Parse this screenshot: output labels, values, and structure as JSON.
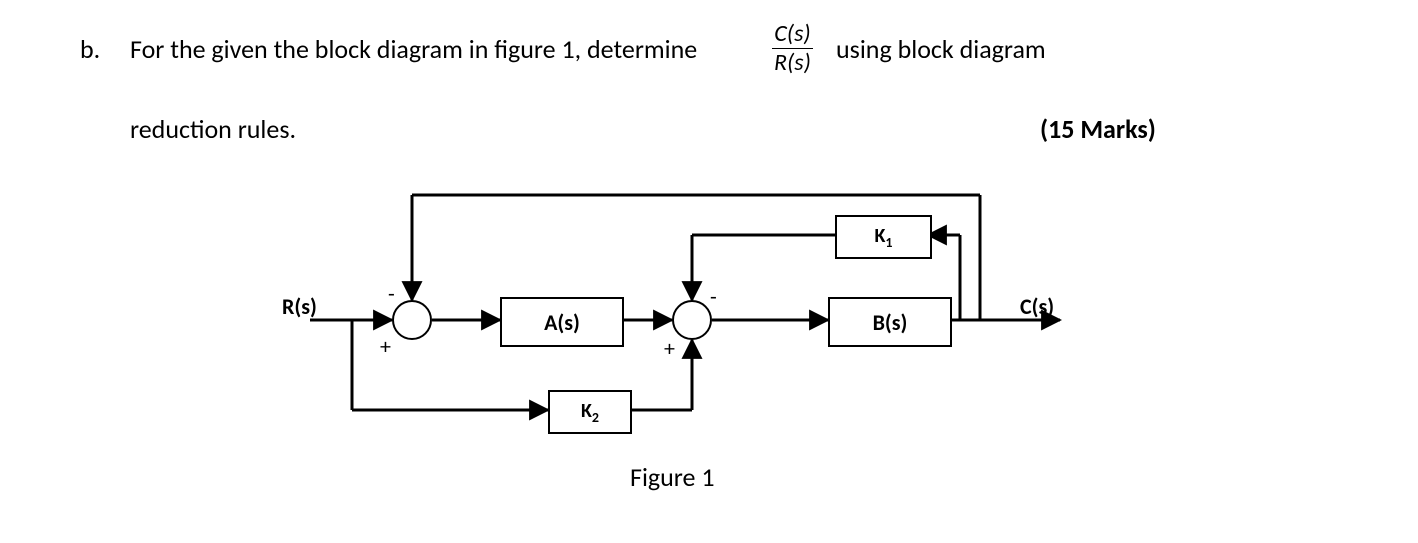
{
  "question": {
    "list_marker": "b.",
    "line1_a": "For the given the block diagram in figure 1, determine",
    "frac_num": "C(s)",
    "frac_den": "R(s)",
    "line1_b": "using block diagram",
    "line2": "reduction rules.",
    "marks": "(15 Marks)"
  },
  "diagram": {
    "input_label": "R(s)",
    "output_label": "C(s)",
    "blocks": {
      "A": "A(s)",
      "B": "B(s)",
      "K1": "K",
      "K1_sub": "1",
      "K2": "K",
      "K2_sub": "2"
    },
    "sums": {
      "s1_plus": "+",
      "s1_minus": "-",
      "s2_plus": "+",
      "s2_minus": "-"
    },
    "caption": "Figure 1"
  },
  "chart_data": {
    "type": "block_diagram",
    "title": "Figure 1",
    "input": "R(s)",
    "output": "C(s)",
    "nodes": [
      {
        "id": "R",
        "type": "input",
        "label": "R(s)"
      },
      {
        "id": "S1",
        "type": "sum",
        "inputs": [
          {
            "from": "R",
            "sign": "+"
          },
          {
            "from": "C",
            "sign": "-"
          }
        ]
      },
      {
        "id": "A",
        "type": "block",
        "label": "A(s)"
      },
      {
        "id": "K2",
        "type": "block",
        "label": "K2"
      },
      {
        "id": "S2",
        "type": "sum",
        "inputs": [
          {
            "from": "A",
            "sign": "+"
          },
          {
            "from": "K2",
            "sign": "+"
          },
          {
            "from": "K1",
            "sign": "-"
          }
        ]
      },
      {
        "id": "B",
        "type": "block",
        "label": "B(s)"
      },
      {
        "id": "K1",
        "type": "block",
        "label": "K1"
      },
      {
        "id": "C",
        "type": "output",
        "label": "C(s)"
      }
    ],
    "edges": [
      {
        "from": "R",
        "to": "S1"
      },
      {
        "from": "S1",
        "to": "A"
      },
      {
        "from": "A",
        "to": "S2"
      },
      {
        "from": "R",
        "to": "K2"
      },
      {
        "from": "K2",
        "to": "S2"
      },
      {
        "from": "S2",
        "to": "B"
      },
      {
        "from": "B",
        "to": "C"
      },
      {
        "from": "C",
        "to": "K1"
      },
      {
        "from": "K1",
        "to": "S2"
      },
      {
        "from": "C",
        "to": "S1"
      }
    ]
  }
}
